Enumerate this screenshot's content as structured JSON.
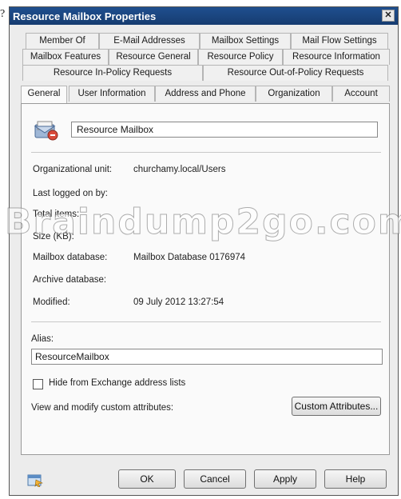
{
  "stray_glyph": "?",
  "window": {
    "title": "Resource Mailbox Properties",
    "close_glyph": "✕"
  },
  "tabs": {
    "row1": [
      "Member Of",
      "E-Mail Addresses",
      "Mailbox Settings",
      "Mail Flow Settings"
    ],
    "row2": [
      "Mailbox Features",
      "Resource General",
      "Resource Policy",
      "Resource Information"
    ],
    "row3": [
      "Resource In-Policy Requests",
      "Resource Out-of-Policy Requests"
    ],
    "row4": [
      "General",
      "User Information",
      "Address and Phone",
      "Organization",
      "Account"
    ],
    "active": "General"
  },
  "general": {
    "display_name": "Resource Mailbox",
    "fields": [
      {
        "label": "Organizational unit:",
        "value": "churchamy.local/Users"
      },
      {
        "label": "Last logged on by:",
        "value": ""
      },
      {
        "label": "Total items:",
        "value": ""
      },
      {
        "label": "Size (KB):",
        "value": ""
      },
      {
        "label": "Mailbox database:",
        "value": "Mailbox Database 0176974"
      },
      {
        "label": "Archive database:",
        "value": ""
      },
      {
        "label": "Modified:",
        "value": "09 July 2012 13:27:54"
      }
    ],
    "alias_label": "Alias:",
    "alias_value": "ResourceMailbox",
    "hide_checkbox_label": "Hide from Exchange address lists",
    "hide_checked": false,
    "custom_attr_label": "View and modify custom attributes:",
    "custom_attr_button": "Custom Attributes..."
  },
  "footer": {
    "ok": "OK",
    "cancel": "Cancel",
    "apply": "Apply",
    "help": "Help"
  },
  "watermark": "Braindump2go.com",
  "icons": {
    "mailbox": "resource-mailbox-icon",
    "help": "help-icon"
  }
}
